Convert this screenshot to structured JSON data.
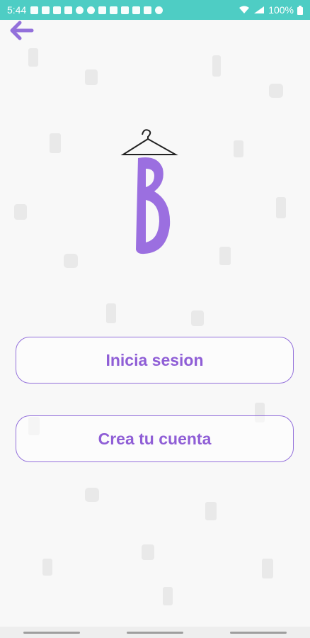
{
  "status_bar": {
    "time": "5:44",
    "battery": "100%",
    "notification_icons": [
      "photo-icon",
      "n-icon",
      "gmail-icon",
      "gmail-icon",
      "instagram-icon",
      "spotify-icon",
      "cloud-icon",
      "android-icon",
      "drive-icon",
      "gmail-icon",
      "image-icon",
      "more-icon"
    ]
  },
  "header": {
    "back_icon": "arrow-back-icon"
  },
  "logo": {
    "letter": "B"
  },
  "buttons": {
    "login_label": "Inicia sesion",
    "signup_label": "Crea tu cuenta"
  },
  "colors": {
    "status_bar": "#4ecdc4",
    "accent": "#9370db",
    "button_text": "#8f5ed6",
    "background": "#f8f8f8"
  }
}
